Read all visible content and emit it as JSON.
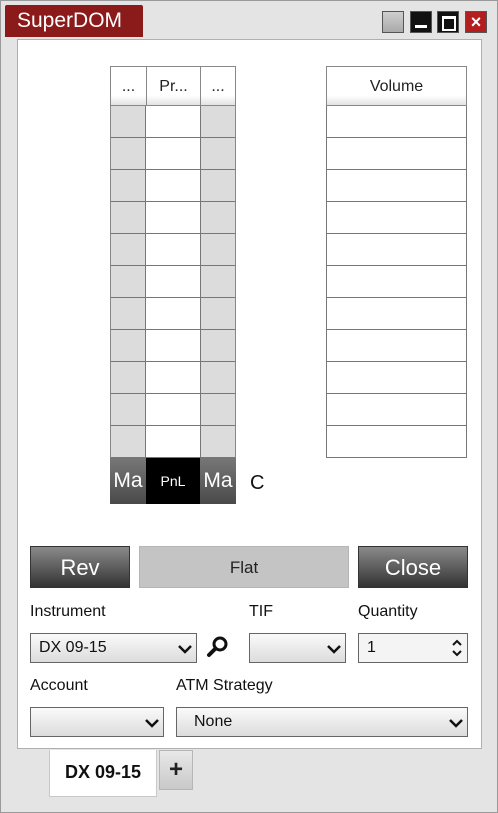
{
  "window": {
    "title": "SuperDOM"
  },
  "ladder": {
    "headers": [
      "...",
      "Pr...",
      "..."
    ],
    "footer": {
      "left": "Ma",
      "center": "PnL",
      "right": "Ma"
    },
    "row_count": 11
  },
  "c_label": "C",
  "volume": {
    "header": "Volume",
    "row_count": 11
  },
  "buttons": {
    "rev": "Rev",
    "flat": "Flat",
    "close": "Close"
  },
  "order": {
    "instrument_label": "Instrument",
    "instrument_value": "DX 09-15",
    "tif_label": "TIF",
    "tif_value": "",
    "quantity_label": "Quantity",
    "quantity_value": "1",
    "account_label": "Account",
    "account_value": "",
    "atm_label": "ATM Strategy",
    "atm_value": "None"
  },
  "tabs": {
    "active": "DX 09-15",
    "add": "+"
  },
  "icons": {
    "search": "magnifier-icon",
    "minimize": "minimize-icon",
    "maximize": "maximize-icon",
    "close": "close-icon",
    "dropdown": "chevron-down-icon",
    "spinner": "spinner-arrows-icon"
  },
  "colors": {
    "title_bg": "#8b1a1a",
    "close_bg": "#b41e1e",
    "pnl_bg": "#000000"
  }
}
